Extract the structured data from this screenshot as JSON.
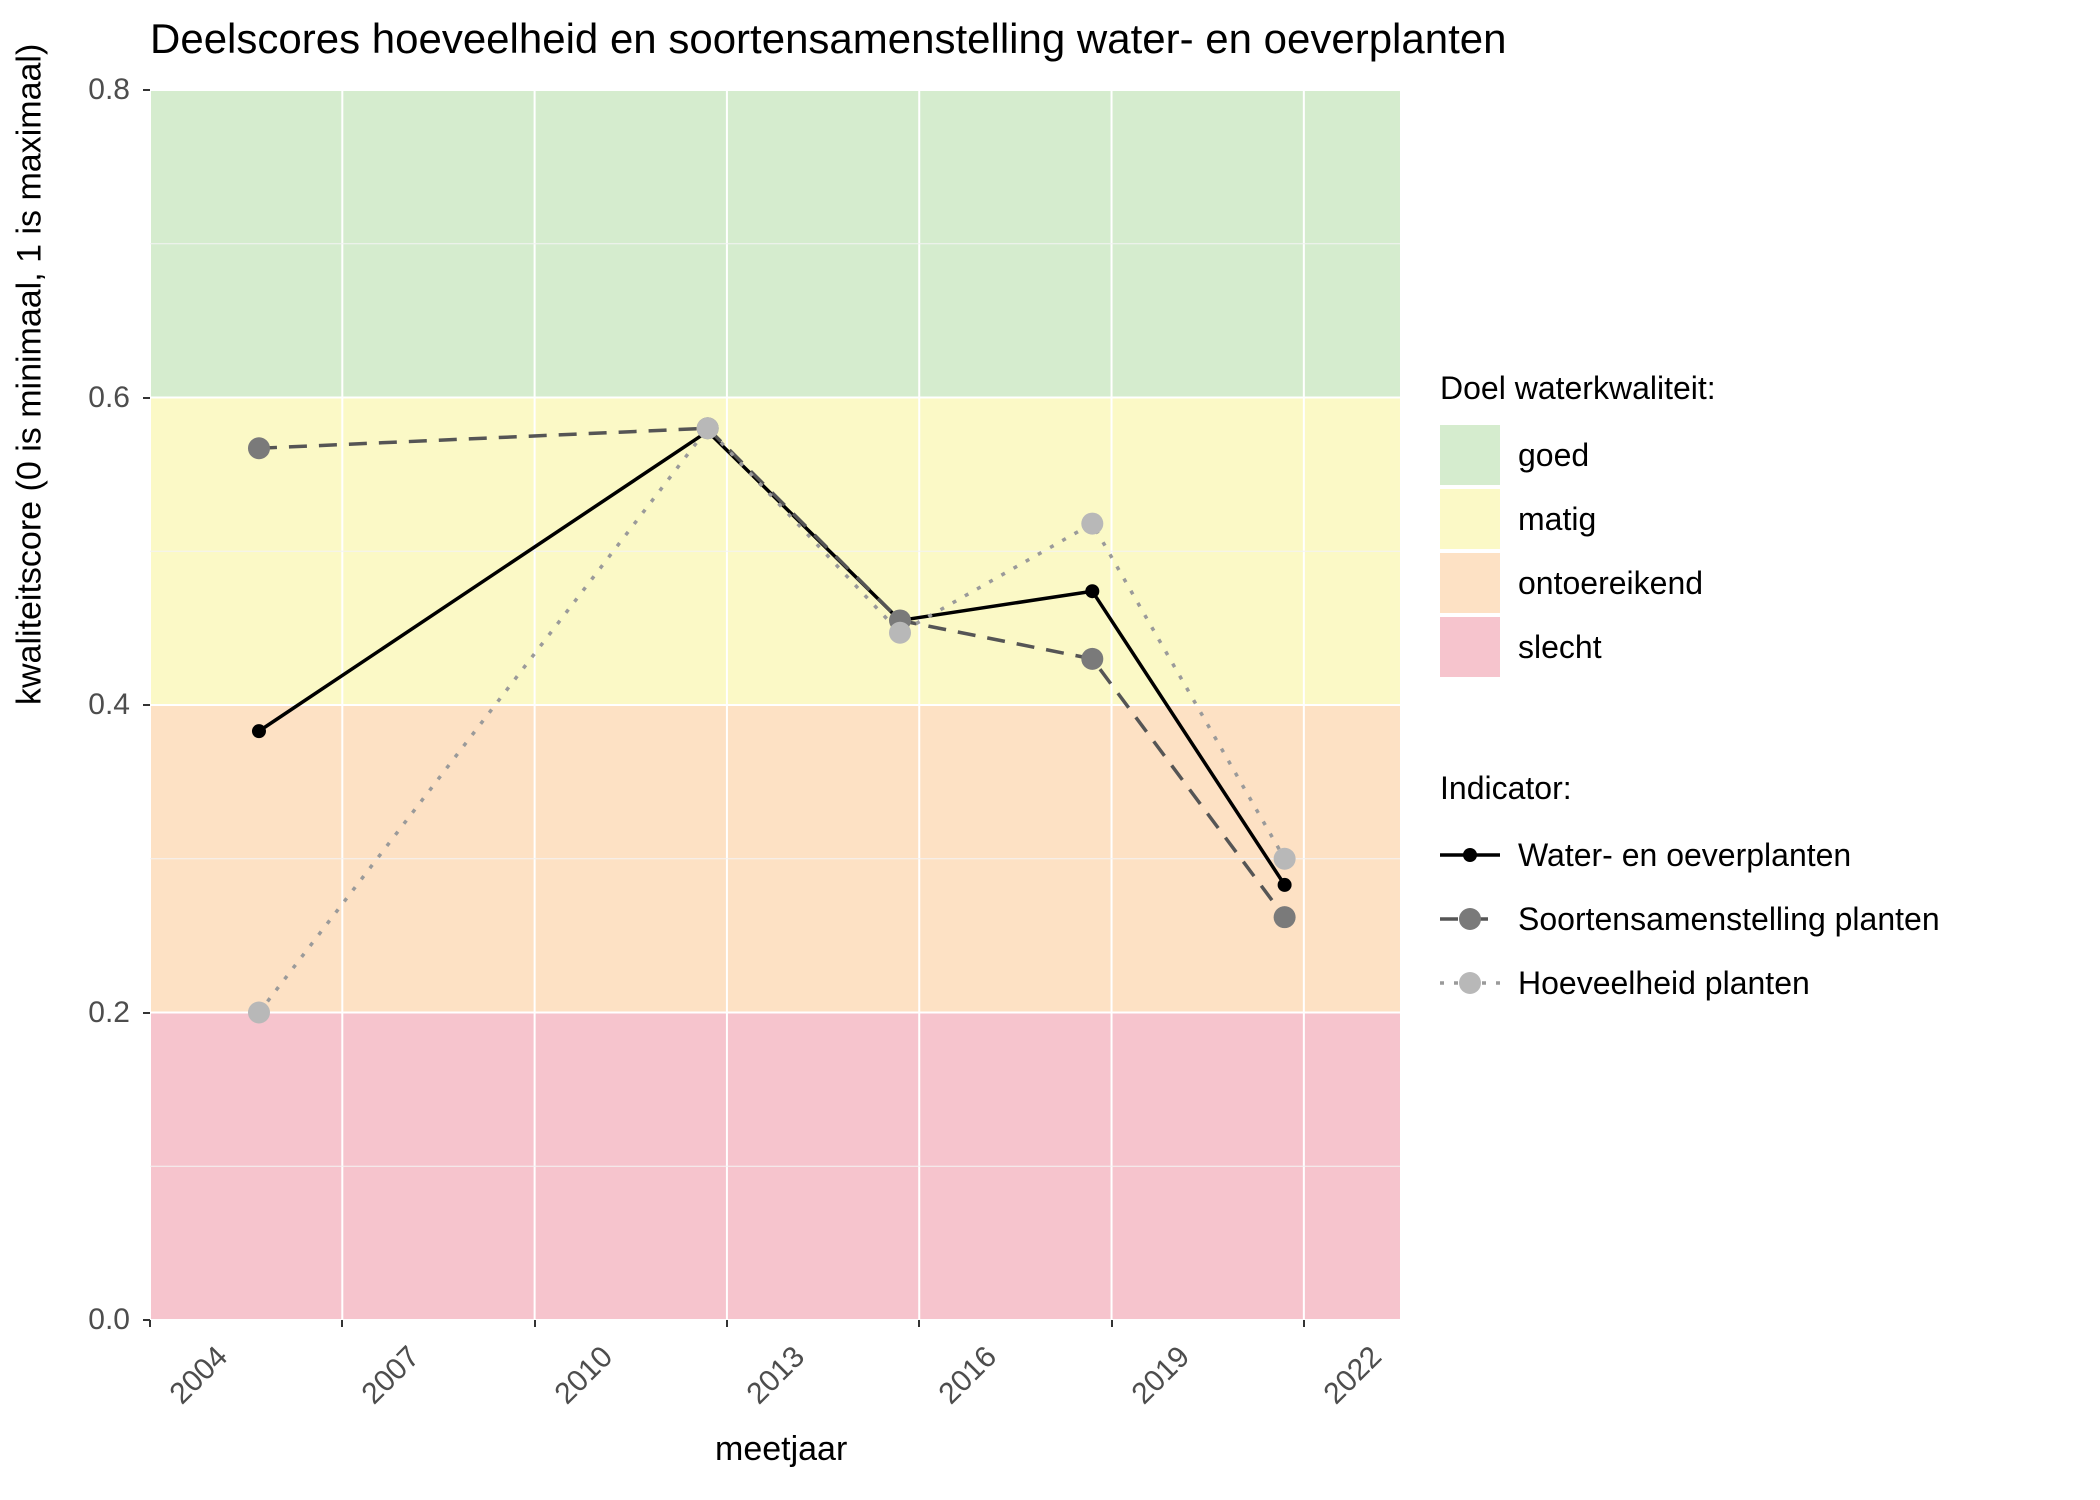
{
  "chart_data": {
    "type": "line",
    "title": "Deelscores hoeveelheid en soortensamenstelling water- en oeverplanten",
    "xlabel": "meetjaar",
    "ylabel": "kwaliteitscore (0 is minimaal, 1 is maximaal)",
    "xlim": [
      2004,
      2023.5
    ],
    "ylim": [
      0.0,
      0.8
    ],
    "x_ticks": [
      2004,
      2007,
      2010,
      2013,
      2016,
      2019,
      2022
    ],
    "y_ticks": [
      0.0,
      0.2,
      0.4,
      0.6,
      0.8
    ],
    "bands": [
      {
        "label": "slecht",
        "from": 0.0,
        "to": 0.2,
        "color": "#f6c4cd"
      },
      {
        "label": "ontoereikend",
        "from": 0.2,
        "to": 0.4,
        "color": "#fde1c4"
      },
      {
        "label": "matig",
        "from": 0.4,
        "to": 0.6,
        "color": "#fbf9c6"
      },
      {
        "label": "goed",
        "from": 0.6,
        "to": 0.8,
        "color": "#d5ecce"
      }
    ],
    "band_legend_title": "Doel waterkwaliteit:",
    "series_legend_title": "Indicator:",
    "x": [
      2005.7,
      2012.7,
      2015.7,
      2018.7,
      2021.7
    ],
    "series": [
      {
        "name": "Water- en oeverplanten",
        "values": [
          0.383,
          0.578,
          0.455,
          0.474,
          0.283
        ],
        "color": "#000000",
        "dash": "solid",
        "marker": "#000000",
        "marker_r": 7
      },
      {
        "name": "Soortensamenstelling planten",
        "values": [
          0.567,
          0.58,
          0.455,
          0.43,
          0.262
        ],
        "color": "#555555",
        "dash": "dashed",
        "marker": "#7a7a7a",
        "marker_r": 11
      },
      {
        "name": "Hoeveelheid planten",
        "values": [
          0.2,
          0.58,
          0.447,
          0.518,
          0.3
        ],
        "color": "#9a9a9a",
        "dash": "dotted",
        "marker": "#b8b8b8",
        "marker_r": 11
      }
    ]
  }
}
